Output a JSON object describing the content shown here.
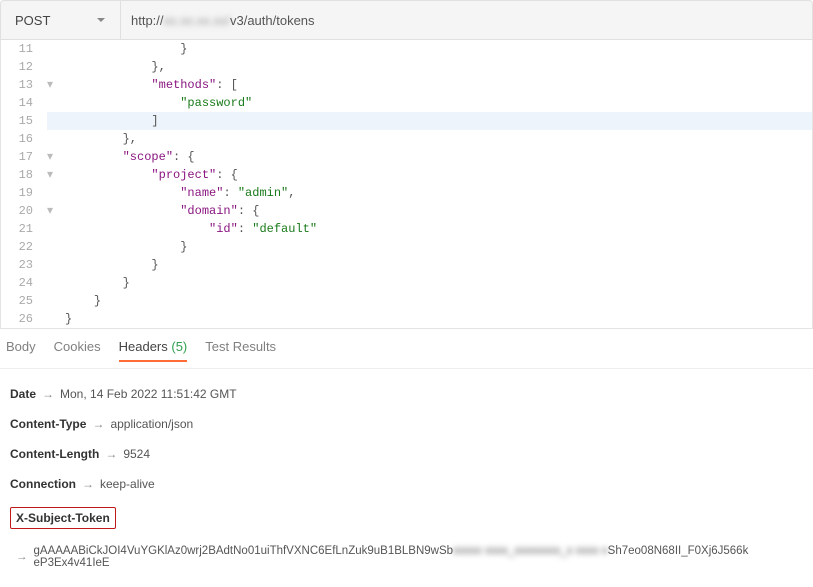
{
  "method": "POST",
  "url_prefix": "http://",
  "url_blurred": "xx.xx.xx.xx/",
  "url_suffix": "v3/auth/tokens",
  "code_lines": [
    {
      "n": 11,
      "fold": "",
      "indent": 16,
      "tokens": [
        {
          "t": "}",
          "c": "pun"
        }
      ]
    },
    {
      "n": 12,
      "fold": "",
      "indent": 12,
      "tokens": [
        {
          "t": "},",
          "c": "pun"
        }
      ]
    },
    {
      "n": 13,
      "fold": "▾",
      "indent": 12,
      "tokens": [
        {
          "t": "\"methods\"",
          "c": "key"
        },
        {
          "t": ": [",
          "c": "pun"
        }
      ]
    },
    {
      "n": 14,
      "fold": "",
      "indent": 16,
      "tokens": [
        {
          "t": "\"password\"",
          "c": "str"
        }
      ]
    },
    {
      "n": 15,
      "fold": "",
      "hl": true,
      "indent": 12,
      "tokens": [
        {
          "t": "]",
          "c": "pun"
        }
      ]
    },
    {
      "n": 16,
      "fold": "",
      "indent": 8,
      "tokens": [
        {
          "t": "},",
          "c": "pun"
        }
      ]
    },
    {
      "n": 17,
      "fold": "▾",
      "indent": 8,
      "tokens": [
        {
          "t": "\"scope\"",
          "c": "key"
        },
        {
          "t": ": {",
          "c": "pun"
        }
      ]
    },
    {
      "n": 18,
      "fold": "▾",
      "indent": 12,
      "tokens": [
        {
          "t": "\"project\"",
          "c": "key"
        },
        {
          "t": ": {",
          "c": "pun"
        }
      ]
    },
    {
      "n": 19,
      "fold": "",
      "indent": 16,
      "tokens": [
        {
          "t": "\"name\"",
          "c": "key"
        },
        {
          "t": ": ",
          "c": "pun"
        },
        {
          "t": "\"admin\"",
          "c": "str"
        },
        {
          "t": ",",
          "c": "pun"
        }
      ]
    },
    {
      "n": 20,
      "fold": "▾",
      "indent": 16,
      "tokens": [
        {
          "t": "\"domain\"",
          "c": "key"
        },
        {
          "t": ": {",
          "c": "pun"
        }
      ]
    },
    {
      "n": 21,
      "fold": "",
      "indent": 20,
      "tokens": [
        {
          "t": "\"id\"",
          "c": "key"
        },
        {
          "t": ": ",
          "c": "pun"
        },
        {
          "t": "\"default\"",
          "c": "str"
        }
      ]
    },
    {
      "n": 22,
      "fold": "",
      "indent": 16,
      "tokens": [
        {
          "t": "}",
          "c": "pun"
        }
      ]
    },
    {
      "n": 23,
      "fold": "",
      "indent": 12,
      "tokens": [
        {
          "t": "}",
          "c": "pun"
        }
      ]
    },
    {
      "n": 24,
      "fold": "",
      "indent": 8,
      "tokens": [
        {
          "t": "}",
          "c": "pun"
        }
      ]
    },
    {
      "n": 25,
      "fold": "",
      "indent": 4,
      "tokens": [
        {
          "t": "}",
          "c": "pun"
        }
      ]
    },
    {
      "n": 26,
      "fold": "",
      "indent": 0,
      "tokens": [
        {
          "t": "}",
          "c": "pun"
        }
      ]
    }
  ],
  "tabs": [
    {
      "label": "Body",
      "active": false
    },
    {
      "label": "Cookies",
      "active": false
    },
    {
      "label": "Headers",
      "count": "(5)",
      "active": true
    },
    {
      "label": "Test Results",
      "active": false
    }
  ],
  "headers": [
    {
      "name": "Date",
      "value": "Mon, 14 Feb 2022 11:51:42 GMT"
    },
    {
      "name": "Content-Type",
      "value": "application/json"
    },
    {
      "name": "Content-Length",
      "value": "9524"
    },
    {
      "name": "Connection",
      "value": "keep-alive"
    }
  ],
  "x_subject_label": "X-Subject-Token",
  "token_value_1": "gAAAAABiCkJOI4VuYGKlAz0wrj2BAdtNo01uiThfVXNC6EfLnZuk9uB1BLBN9wSb",
  "token_value_blur": "xxxxx xxxx_xxxxxxxx_x xxxx x",
  "token_value_2": "Sh7eo08N68II_F0Xj6J566k",
  "token_value_3": "eP3Ex4v41IeE"
}
